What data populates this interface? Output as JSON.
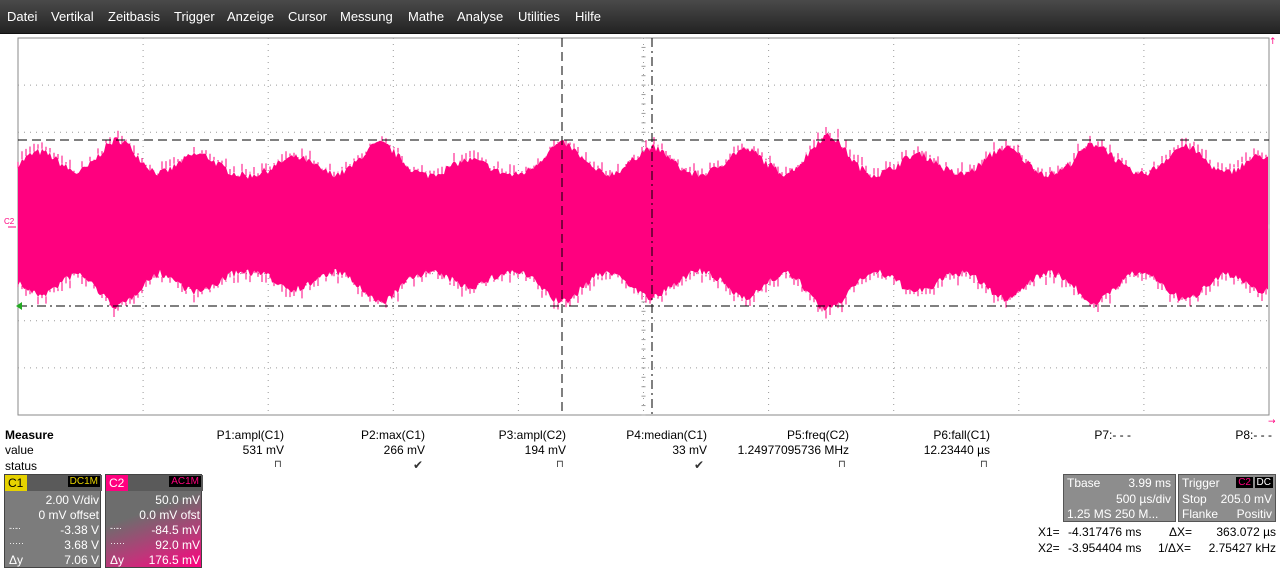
{
  "menu": [
    "Datei",
    "Vertikal",
    "Zeitbasis",
    "Trigger",
    "Anzeige",
    "Cursor",
    "Messung",
    "Mathe",
    "Analyse",
    "Utilities",
    "Hilfe"
  ],
  "colors": {
    "trace": "#ff007f",
    "c1": "#e6d200",
    "c2": "#ff007f",
    "grid": "#9a9a9a"
  },
  "screen": {
    "channel_marker": "C2"
  },
  "measure": {
    "title": "Measure",
    "rows": [
      "value",
      "status"
    ],
    "params": [
      {
        "name": "P1:ampl(C1)",
        "value": "531 mV",
        "status": "⊓"
      },
      {
        "name": "P2:max(C1)",
        "value": "266 mV",
        "status": "✔"
      },
      {
        "name": "P3:ampl(C2)",
        "value": "194 mV",
        "status": "⊓"
      },
      {
        "name": "P4:median(C1)",
        "value": "33 mV",
        "status": "✔"
      },
      {
        "name": "P5:freq(C2)",
        "value": "1.24977095736 MHz",
        "status": "⊓"
      },
      {
        "name": "P6:fall(C1)",
        "value": "12.23440 µs",
        "status": "⊓"
      },
      {
        "name": "P7:- - -",
        "value": "",
        "status": ""
      },
      {
        "name": "P8:- - -",
        "value": "",
        "status": ""
      }
    ]
  },
  "c1": {
    "label": "C1",
    "coupling": "DC1M",
    "vdiv": "2.00 V/div",
    "offset": "0 mV offset",
    "cursor1": "-3.38 V",
    "cursor2": "3.68 V",
    "dy_label": "Δy",
    "dy": "7.06 V"
  },
  "c2": {
    "label": "C2",
    "coupling": "AC1M",
    "vdiv": "50.0 mV",
    "offset": "0.0 mV ofst",
    "cursor1": "-84.5 mV",
    "cursor2": "92.0 mV",
    "dy_label": "Δy",
    "dy": "176.5 mV"
  },
  "tbase": {
    "label": "Tbase",
    "value": "3.99 ms",
    "div": "500 µs/div",
    "rate": "1.25 MS   250 M..."
  },
  "trigger": {
    "label": "Trigger",
    "channel": "C2",
    "coupling": "DC",
    "mode": "Stop",
    "level": "205.0 mV",
    "type": "Flanke",
    "slope": "Positiv"
  },
  "cursors": {
    "x1_label": "X1=",
    "x1": "-4.317476 ms",
    "dx_label": "ΔX=",
    "dx": "363.072 µs",
    "x2_label": "X2=",
    "x2": "-3.954404 ms",
    "inv_dx_label": "1/ΔX=",
    "inv_dx": "2.75427 kHz"
  }
}
